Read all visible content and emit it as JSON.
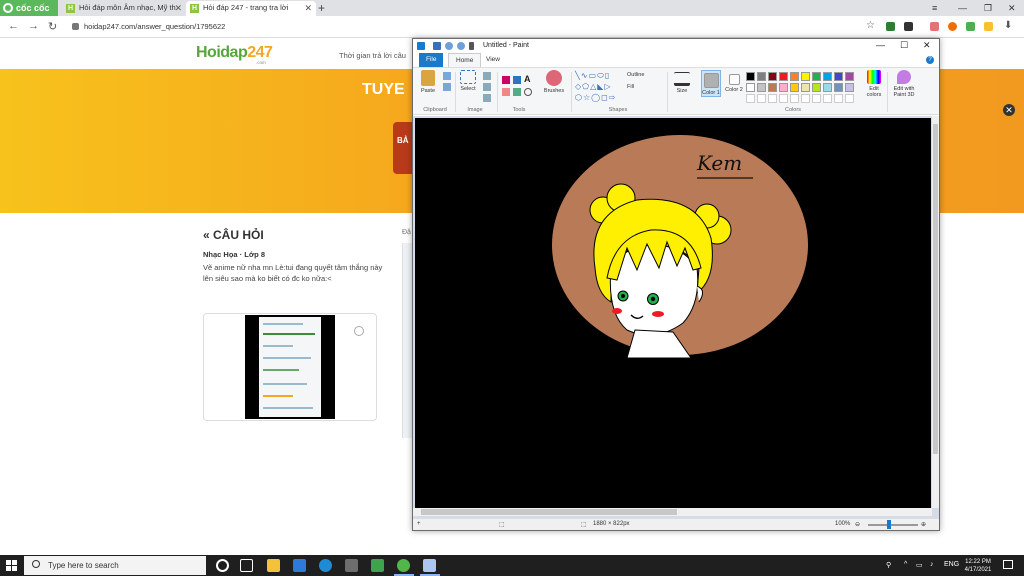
{
  "browser": {
    "brand": "cốc cốc",
    "tabs": [
      {
        "title": "Hỏi đáp môn Âm nhạc, Mỹ th"
      },
      {
        "title": "Hỏi đáp 247 - trang tra lời"
      }
    ],
    "favicon_letter": "H",
    "url": "hoidap247.com/answer_question/1795622"
  },
  "site": {
    "logo_main": "Hoidap",
    "logo_accent": "247",
    "logo_sub": ".com",
    "header_text": "Thời gian trả lời câu",
    "banner_title": "TUYE",
    "banner_card_text": "BẢ",
    "banner_close": "✕",
    "question": {
      "heading": "« CÂU HỎI",
      "subject": "Nhạc Họa · Lớp 8",
      "body": "Vẽ anime nữ nha mn Lè:tui đang quyết tâm thắng này lên siêu sao mà ko biết có đc ko nữa:<"
    },
    "side_label": "Đặ"
  },
  "paint": {
    "title": "Untitled - Paint",
    "menus": {
      "file": "File",
      "home": "Home",
      "view": "View"
    },
    "help": "?",
    "ribbon": {
      "paste": "Paste",
      "select": "Select",
      "brushes": "Brushes",
      "outline": "Outline",
      "fill": "Fill",
      "size": "Size",
      "color1": "Color 1",
      "color2": "Color 2",
      "edit_colors": "Edit colors",
      "edit_paint3d": "Edit with Paint 3D",
      "groups": {
        "clipboard": "Clipboard",
        "image": "Image",
        "tools": "Tools",
        "shapes": "Shapes",
        "colors": "Colors"
      }
    },
    "palette": [
      "#000000",
      "#7f7f7f",
      "#880015",
      "#ed1c24",
      "#ff7f27",
      "#fff200",
      "#22b14c",
      "#00a2e8",
      "#3f48cc",
      "#a349a4",
      "#ffffff",
      "#c3c3c3",
      "#b97a57",
      "#ffaec9",
      "#ffc90e",
      "#efe4b0",
      "#b5e61d",
      "#99d9ea",
      "#7092be",
      "#c8bfe7"
    ],
    "color1_hex": "#b0b0b0",
    "color2_hex": "#ffffff",
    "canvas": {
      "background": "#000000",
      "circle_color": "#b97a57",
      "hair_color": "#ffef00",
      "eye_color": "#22b14c",
      "blush_color": "#ed1c24",
      "signature": "Kem"
    },
    "status": {
      "dimensions": "1880 × 822px",
      "zoom": "100%"
    }
  },
  "taskbar": {
    "search_placeholder": "Type here to search",
    "language": "ENG",
    "time": "12:22 PM",
    "date": "4/17/2021"
  }
}
